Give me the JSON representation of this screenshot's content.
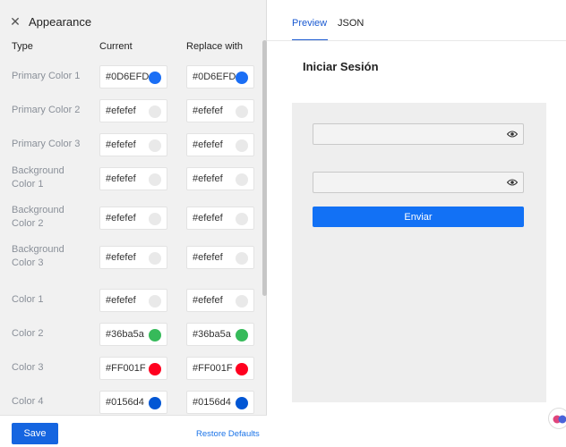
{
  "panel": {
    "title": "Appearance",
    "close_icon": "close-icon"
  },
  "columns": {
    "type": "Type",
    "current": "Current",
    "replace": "Replace with"
  },
  "rows": [
    {
      "type_line1": "Primary Color 1",
      "type_line2": "",
      "current": "#0D6EFD",
      "current_color": "#1a6ef5",
      "replace": "#0D6EFD",
      "replace_color": "#1a6ef5"
    },
    {
      "type_line1": "Primary Color 2",
      "type_line2": "",
      "current": "#efefef",
      "current_color": "#efefef",
      "replace": "#efefef",
      "replace_color": "#efefef"
    },
    {
      "type_line1": "Primary Color 3",
      "type_line2": "",
      "current": "#efefef",
      "current_color": "#efefef",
      "replace": "#efefef",
      "replace_color": "#efefef"
    },
    {
      "type_line1": "Background",
      "type_line2": "Color 1",
      "current": "#efefef",
      "current_color": "#efefef",
      "replace": "#efefef",
      "replace_color": "#efefef"
    },
    {
      "type_line1": "Background",
      "type_line2": "Color 2",
      "current": "#efefef",
      "current_color": "#efefef",
      "replace": "#efefef",
      "replace_color": "#efefef"
    },
    {
      "type_line1": "Background",
      "type_line2": "Color 3",
      "current": "#efefef",
      "current_color": "#efefef",
      "replace": "#efefef",
      "replace_color": "#efefef"
    },
    {
      "type_line1": "Color 1",
      "type_line2": "",
      "current": "#efefef",
      "current_color": "#efefef",
      "replace": "#efefef",
      "replace_color": "#efefef"
    },
    {
      "type_line1": "Color 2",
      "type_line2": "",
      "current": "#36ba5a",
      "current_color": "#36ba5a",
      "replace": "#36ba5a",
      "replace_color": "#36ba5a"
    },
    {
      "type_line1": "Color 3",
      "type_line2": "",
      "current": "#FF001F",
      "current_color": "#ff001f",
      "replace": "#FF001F",
      "replace_color": "#ff001f"
    },
    {
      "type_line1": "Color 4",
      "type_line2": "",
      "current": "#0156d4",
      "current_color": "#0156d4",
      "replace": "#0156d4",
      "replace_color": "#0156d4"
    }
  ],
  "footer": {
    "save_label": "Save",
    "restore_label": "Restore Defaults"
  },
  "tabs": [
    {
      "label": "Preview",
      "active": true
    },
    {
      "label": "JSON",
      "active": false
    }
  ],
  "preview": {
    "title": "Iniciar Sesión",
    "fields": [
      {
        "icon": "eye-icon"
      },
      {
        "icon": "eye-icon"
      }
    ],
    "submit_label": "Enviar"
  },
  "colors": {
    "accent": "#1565e0",
    "button": "#1271f5",
    "link": "#1a73e8"
  }
}
